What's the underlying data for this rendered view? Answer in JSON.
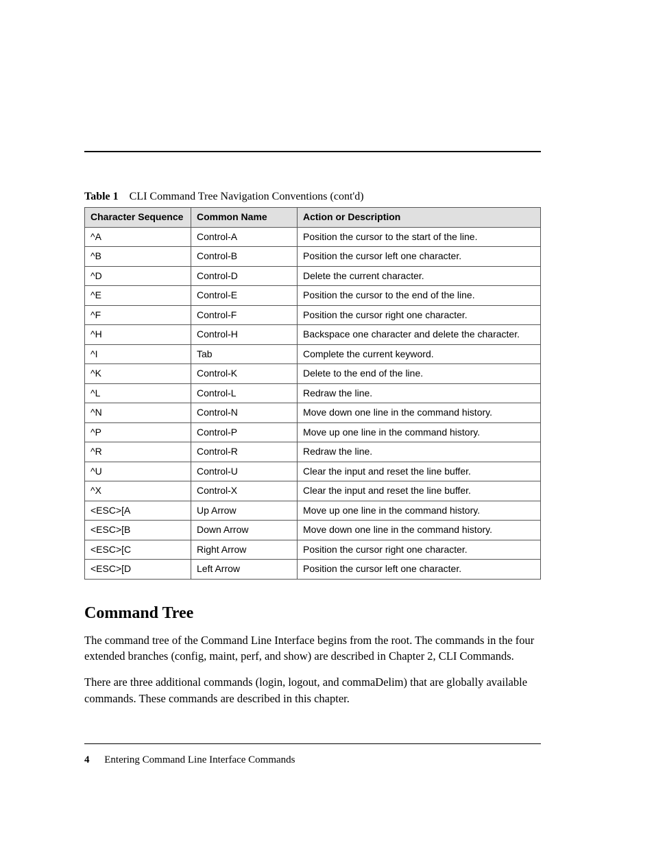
{
  "tableCaption": {
    "label": "Table 1",
    "title": "CLI Command Tree Navigation Conventions  (cont'd)"
  },
  "headers": {
    "col1": "Character Sequence",
    "col2": "Common Name",
    "col3": "Action or Description"
  },
  "rows": [
    {
      "seq": "^A",
      "name": "Control-A",
      "desc": "Position the cursor to the start of the line."
    },
    {
      "seq": "^B",
      "name": "Control-B",
      "desc": "Position the cursor left one character."
    },
    {
      "seq": "^D",
      "name": "Control-D",
      "desc": "Delete the current character."
    },
    {
      "seq": "^E",
      "name": "Control-E",
      "desc": "Position the cursor to the end of the line."
    },
    {
      "seq": "^F",
      "name": "Control-F",
      "desc": "Position the cursor right one character."
    },
    {
      "seq": "^H",
      "name": "Control-H",
      "desc": "Backspace one character and delete the character."
    },
    {
      "seq": "^I",
      "name": "Tab",
      "desc": "Complete the current keyword."
    },
    {
      "seq": "^K",
      "name": "Control-K",
      "desc": "Delete to the end of the line."
    },
    {
      "seq": "^L",
      "name": "Control-L",
      "desc": "Redraw the line."
    },
    {
      "seq": "^N",
      "name": "Control-N",
      "desc": "Move down one line in the command history."
    },
    {
      "seq": "^P",
      "name": "Control-P",
      "desc": "Move up one line in the command history."
    },
    {
      "seq": "^R",
      "name": "Control-R",
      "desc": "Redraw the line."
    },
    {
      "seq": "^U",
      "name": "Control-U",
      "desc": "Clear the input and reset the line buffer."
    },
    {
      "seq": "^X",
      "name": "Control-X",
      "desc": "Clear the input and reset the line buffer."
    },
    {
      "seq": "<ESC>[A",
      "name": "Up Arrow",
      "desc": "Move up one line in the command history."
    },
    {
      "seq": "<ESC>[B",
      "name": "Down Arrow",
      "desc": "Move down one line in the command history."
    },
    {
      "seq": "<ESC>[C",
      "name": "Right Arrow",
      "desc": "Position the cursor right one character."
    },
    {
      "seq": "<ESC>[D",
      "name": "Left Arrow",
      "desc": "Position the cursor left one character."
    }
  ],
  "section": {
    "heading": "Command Tree",
    "para1": "The command tree of the Command Line Interface begins from the root. The commands in the four extended branches (config, maint, perf, and show) are described in Chapter 2, CLI Commands.",
    "para2": "There are three additional commands (login, logout, and commaDelim) that are globally available commands. These commands are described in this chapter."
  },
  "footer": {
    "page": "4",
    "title": "Entering Command Line Interface Commands"
  }
}
